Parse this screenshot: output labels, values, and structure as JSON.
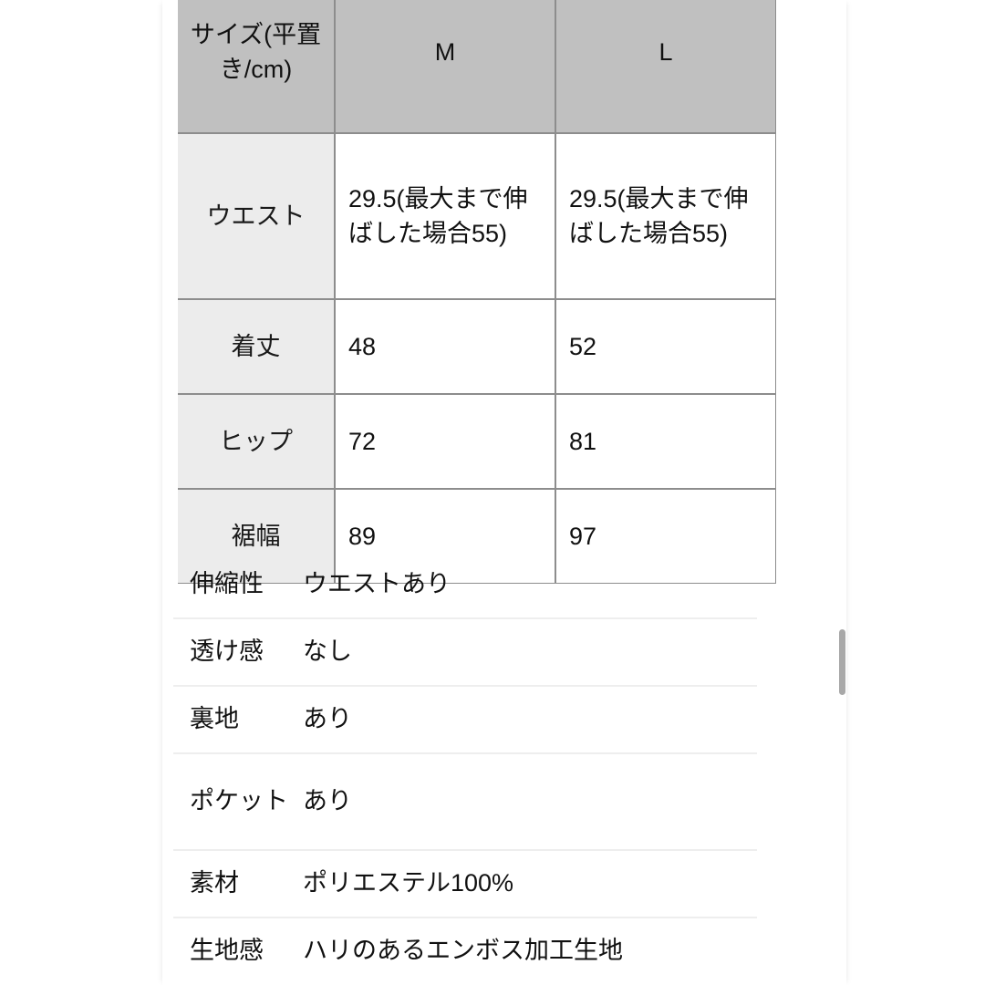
{
  "size_table": {
    "headers": [
      "サイズ(平置き/cm)",
      "M",
      "L"
    ],
    "rows": [
      {
        "label": "ウエスト",
        "m": "29.5(最大まで伸ばした場合55)",
        "l": "29.5(最大まで伸ばした場合55)"
      },
      {
        "label": "着丈",
        "m": "48",
        "l": "52"
      },
      {
        "label": "ヒップ",
        "m": "72",
        "l": "81"
      },
      {
        "label": "裾幅",
        "m": "89",
        "l": "97"
      }
    ]
  },
  "spec_list": {
    "rows": [
      {
        "label": "伸縮性",
        "value": "ウエストあり"
      },
      {
        "label": "透け感",
        "value": "なし"
      },
      {
        "label": "裏地",
        "value": "あり"
      },
      {
        "label": "ポケット",
        "value": "あり"
      },
      {
        "label": "素材",
        "value": "ポリエステル100%"
      },
      {
        "label": "生地感",
        "value": "ハリのあるエンボス加工生地"
      }
    ]
  },
  "colors": {
    "header_bg": "#c0c0c0",
    "label_bg": "#ececec",
    "border": "#8d8d8d",
    "divider": "#eeeeee",
    "text": "#111111",
    "scrollbar_thumb": "#a8a8a8"
  }
}
